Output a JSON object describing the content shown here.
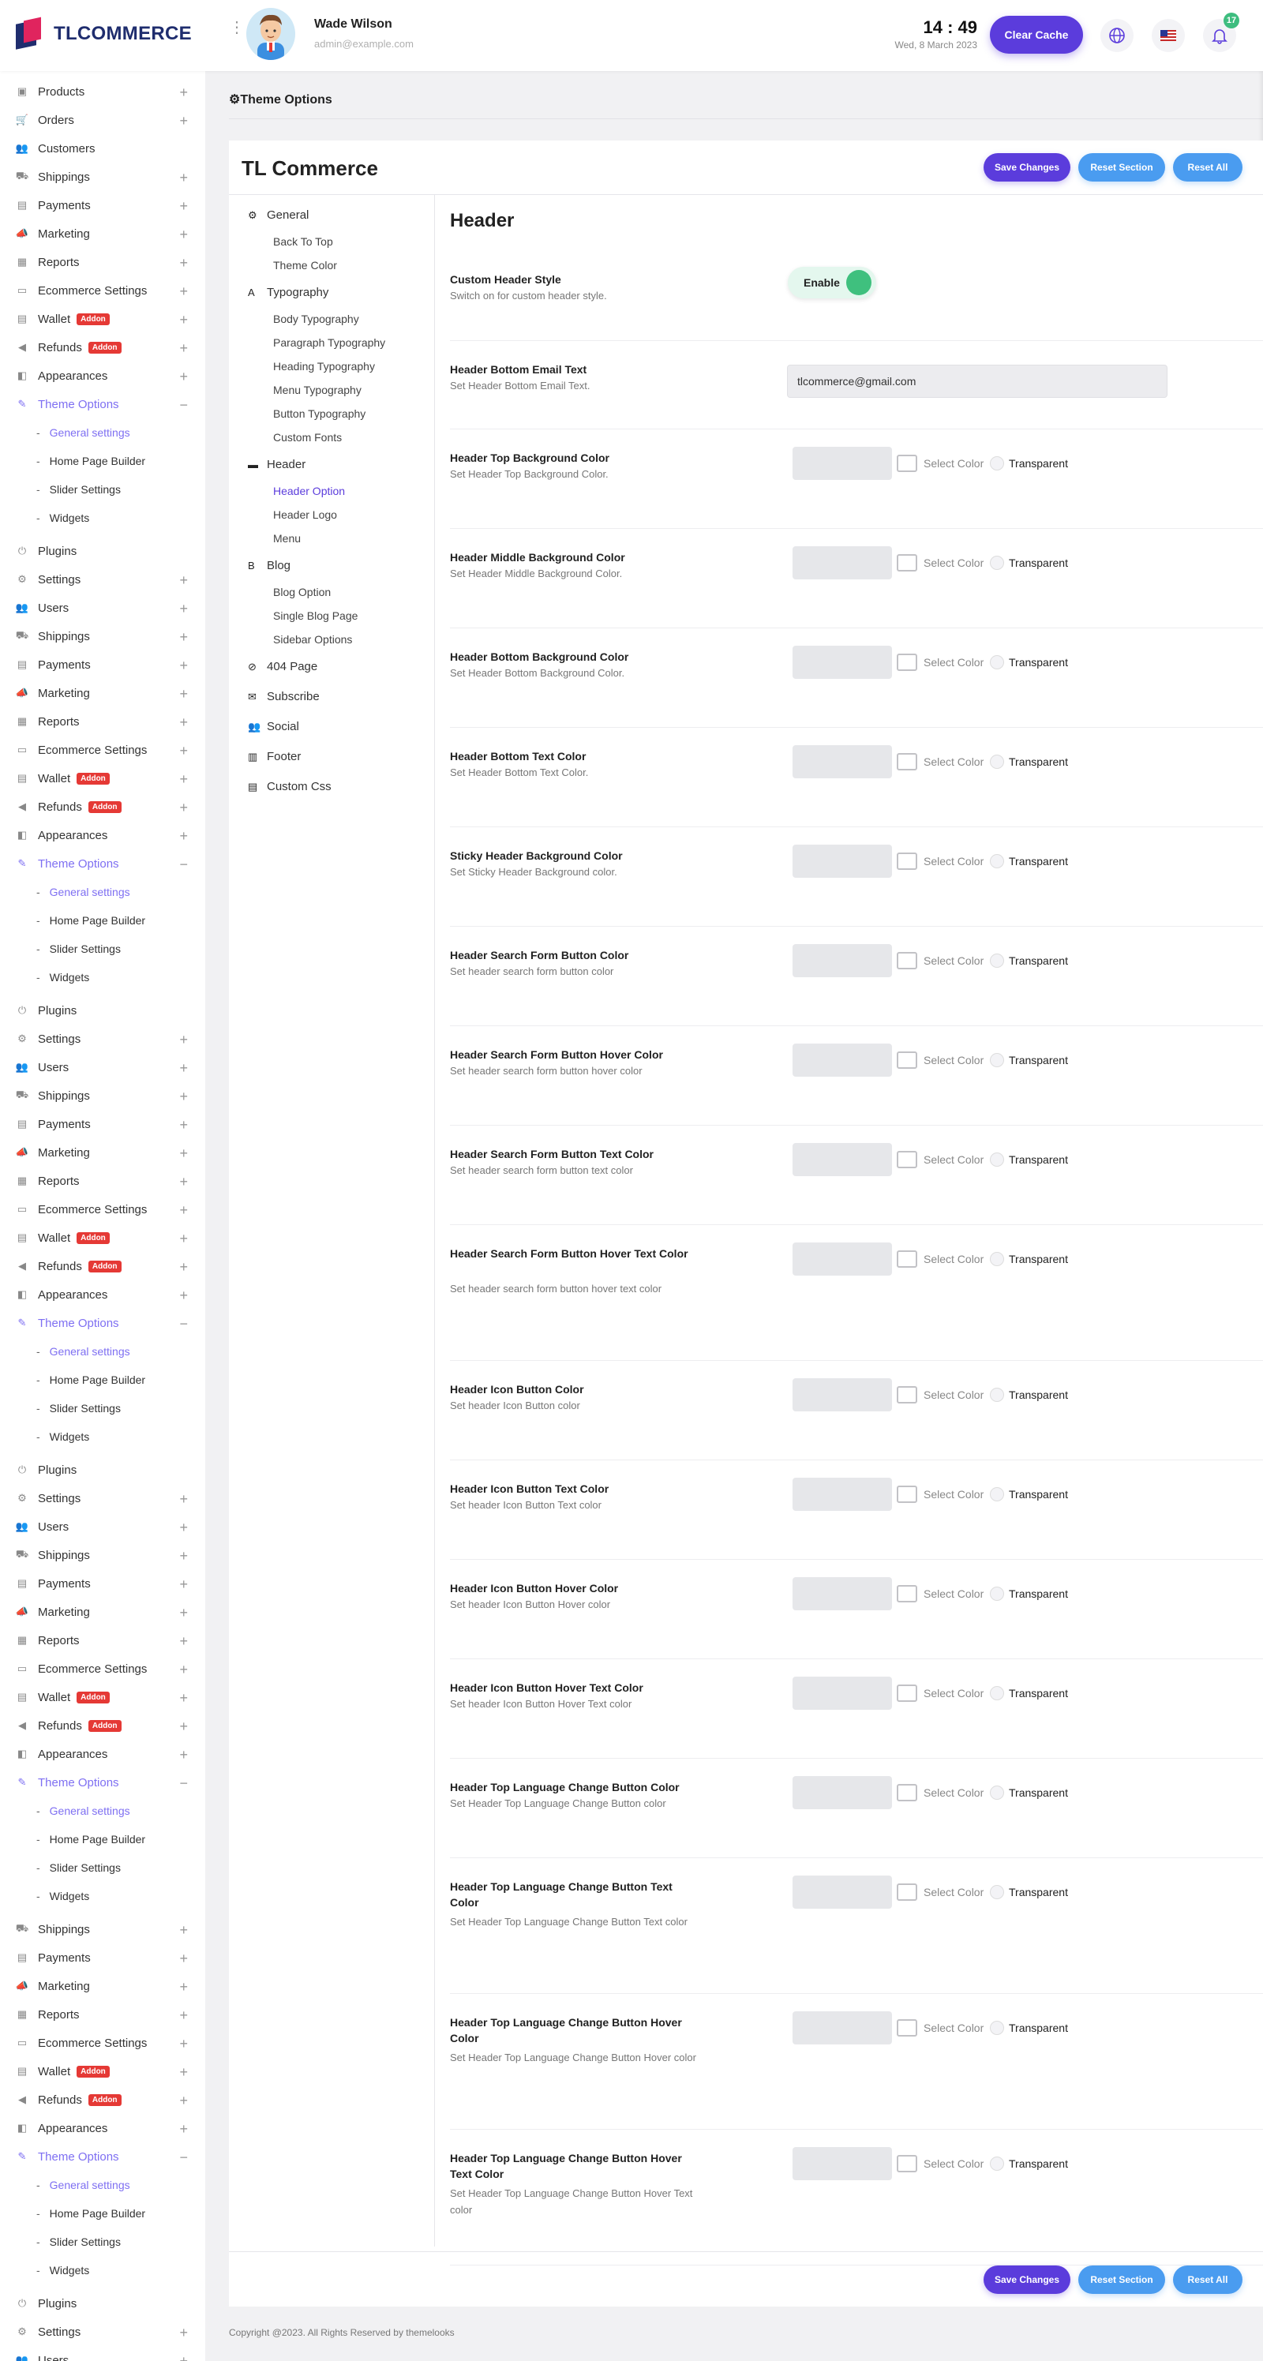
{
  "header": {
    "logo_text": "TLCOMMERCE",
    "user_name": "Wade Wilson",
    "user_email": "admin@example.com",
    "time": "14 : 49",
    "date": "Wed, 8 March 2023",
    "clear_cache_label": "Clear Cache",
    "notification_count": "17",
    "icons": [
      "globe-icon",
      "us-flag-icon",
      "bell-icon"
    ],
    "accent_color": "#5b3cdc"
  },
  "sidebar": {
    "groups": [
      {
        "type": "item",
        "label": "Products",
        "icon": "box-icon",
        "expandable": true
      },
      {
        "type": "item",
        "label": "Orders",
        "icon": "cart-icon",
        "expandable": true
      },
      {
        "type": "item",
        "label": "Customers",
        "icon": "users-icon",
        "expandable": false
      },
      {
        "type": "item",
        "label": "Shippings",
        "icon": "truck-icon",
        "expandable": true
      },
      {
        "type": "item",
        "label": "Payments",
        "icon": "wallet-icon",
        "expandable": true
      },
      {
        "type": "item",
        "label": "Marketing",
        "icon": "megaphone-icon",
        "expandable": true
      },
      {
        "type": "item",
        "label": "Reports",
        "icon": "report-icon",
        "expandable": true
      },
      {
        "type": "item",
        "label": "Ecommerce Settings",
        "icon": "card-icon",
        "expandable": true
      },
      {
        "type": "item",
        "label": "Wallet",
        "icon": "wallet-icon",
        "expandable": true,
        "addon": "Addon"
      },
      {
        "type": "item",
        "label": "Refunds",
        "icon": "refund-icon",
        "expandable": true,
        "addon": "Addon"
      },
      {
        "type": "item",
        "label": "Appearances",
        "icon": "palette-icon",
        "expandable": true
      },
      {
        "type": "item",
        "label": "Theme Options",
        "icon": "brush-icon",
        "expandable": true,
        "active": true,
        "open": true
      },
      {
        "type": "sub",
        "label": "General settings",
        "active": true
      },
      {
        "type": "sub",
        "label": "Home Page Builder"
      },
      {
        "type": "sub",
        "label": "Slider Settings"
      },
      {
        "type": "sub",
        "label": "Widgets"
      },
      {
        "type": "gap"
      },
      {
        "type": "item",
        "label": "Plugins",
        "icon": "plug-icon",
        "expandable": false
      },
      {
        "type": "item",
        "label": "Settings",
        "icon": "gear-icon",
        "expandable": true
      },
      {
        "type": "item",
        "label": "Users",
        "icon": "users-icon",
        "expandable": true
      },
      {
        "type": "item",
        "label": "Shippings",
        "icon": "truck-icon",
        "expandable": true
      },
      {
        "type": "item",
        "label": "Payments",
        "icon": "wallet-icon",
        "expandable": true
      },
      {
        "type": "item",
        "label": "Marketing",
        "icon": "megaphone-icon",
        "expandable": true
      },
      {
        "type": "item",
        "label": "Reports",
        "icon": "report-icon",
        "expandable": true
      },
      {
        "type": "item",
        "label": "Ecommerce Settings",
        "icon": "card-icon",
        "expandable": true
      },
      {
        "type": "item",
        "label": "Wallet",
        "icon": "wallet-icon",
        "expandable": true,
        "addon": "Addon"
      },
      {
        "type": "item",
        "label": "Refunds",
        "icon": "refund-icon",
        "expandable": true,
        "addon": "Addon"
      },
      {
        "type": "item",
        "label": "Appearances",
        "icon": "palette-icon",
        "expandable": true
      },
      {
        "type": "item",
        "label": "Theme Options",
        "icon": "brush-icon",
        "expandable": true,
        "active": true,
        "open": true
      },
      {
        "type": "sub",
        "label": "General settings",
        "active": true
      },
      {
        "type": "sub",
        "label": "Home Page Builder"
      },
      {
        "type": "sub",
        "label": "Slider Settings"
      },
      {
        "type": "sub",
        "label": "Widgets"
      },
      {
        "type": "gap"
      },
      {
        "type": "item",
        "label": "Plugins",
        "icon": "plug-icon",
        "expandable": false
      },
      {
        "type": "item",
        "label": "Settings",
        "icon": "gear-icon",
        "expandable": true
      },
      {
        "type": "item",
        "label": "Users",
        "icon": "users-icon",
        "expandable": true
      },
      {
        "type": "item",
        "label": "Shippings",
        "icon": "truck-icon",
        "expandable": true
      },
      {
        "type": "item",
        "label": "Payments",
        "icon": "wallet-icon",
        "expandable": true
      },
      {
        "type": "item",
        "label": "Marketing",
        "icon": "megaphone-icon",
        "expandable": true
      },
      {
        "type": "item",
        "label": "Reports",
        "icon": "report-icon",
        "expandable": true
      },
      {
        "type": "item",
        "label": "Ecommerce Settings",
        "icon": "card-icon",
        "expandable": true
      },
      {
        "type": "item",
        "label": "Wallet",
        "icon": "wallet-icon",
        "expandable": true,
        "addon": "Addon"
      },
      {
        "type": "item",
        "label": "Refunds",
        "icon": "refund-icon",
        "expandable": true,
        "addon": "Addon"
      },
      {
        "type": "item",
        "label": "Appearances",
        "icon": "palette-icon",
        "expandable": true
      },
      {
        "type": "item",
        "label": "Theme Options",
        "icon": "brush-icon",
        "expandable": true,
        "active": true,
        "open": true
      },
      {
        "type": "sub",
        "label": "General settings",
        "active": true
      },
      {
        "type": "sub",
        "label": "Home Page Builder"
      },
      {
        "type": "sub",
        "label": "Slider Settings"
      },
      {
        "type": "sub",
        "label": "Widgets"
      },
      {
        "type": "gap"
      },
      {
        "type": "item",
        "label": "Plugins",
        "icon": "plug-icon",
        "expandable": false
      },
      {
        "type": "item",
        "label": "Settings",
        "icon": "gear-icon",
        "expandable": true
      },
      {
        "type": "item",
        "label": "Users",
        "icon": "users-icon",
        "expandable": true
      },
      {
        "type": "item",
        "label": "Shippings",
        "icon": "truck-icon",
        "expandable": true
      },
      {
        "type": "item",
        "label": "Payments",
        "icon": "wallet-icon",
        "expandable": true
      },
      {
        "type": "item",
        "label": "Marketing",
        "icon": "megaphone-icon",
        "expandable": true
      },
      {
        "type": "item",
        "label": "Reports",
        "icon": "report-icon",
        "expandable": true
      },
      {
        "type": "item",
        "label": "Ecommerce Settings",
        "icon": "card-icon",
        "expandable": true
      },
      {
        "type": "item",
        "label": "Wallet",
        "icon": "wallet-icon",
        "expandable": true,
        "addon": "Addon"
      },
      {
        "type": "item",
        "label": "Refunds",
        "icon": "refund-icon",
        "expandable": true,
        "addon": "Addon"
      },
      {
        "type": "item",
        "label": "Appearances",
        "icon": "palette-icon",
        "expandable": true
      },
      {
        "type": "item",
        "label": "Theme Options",
        "icon": "brush-icon",
        "expandable": true,
        "active": true,
        "open": true
      },
      {
        "type": "sub",
        "label": "General settings",
        "active": true
      },
      {
        "type": "sub",
        "label": "Home Page Builder"
      },
      {
        "type": "sub",
        "label": "Slider Settings"
      },
      {
        "type": "sub",
        "label": "Widgets"
      },
      {
        "type": "gap"
      },
      {
        "type": "item",
        "label": "Shippings",
        "icon": "truck-icon",
        "expandable": true
      },
      {
        "type": "item",
        "label": "Payments",
        "icon": "wallet-icon",
        "expandable": true
      },
      {
        "type": "item",
        "label": "Marketing",
        "icon": "megaphone-icon",
        "expandable": true
      },
      {
        "type": "item",
        "label": "Reports",
        "icon": "report-icon",
        "expandable": true
      },
      {
        "type": "item",
        "label": "Ecommerce Settings",
        "icon": "card-icon",
        "expandable": true
      },
      {
        "type": "item",
        "label": "Wallet",
        "icon": "wallet-icon",
        "expandable": true,
        "addon": "Addon"
      },
      {
        "type": "item",
        "label": "Refunds",
        "icon": "refund-icon",
        "expandable": true,
        "addon": "Addon"
      },
      {
        "type": "item",
        "label": "Appearances",
        "icon": "palette-icon",
        "expandable": true
      },
      {
        "type": "item",
        "label": "Theme Options",
        "icon": "brush-icon",
        "expandable": true,
        "active": true,
        "open": true
      },
      {
        "type": "sub",
        "label": "General settings",
        "active": true
      },
      {
        "type": "sub",
        "label": "Home Page Builder"
      },
      {
        "type": "sub",
        "label": "Slider Settings"
      },
      {
        "type": "sub",
        "label": "Widgets"
      },
      {
        "type": "gap"
      },
      {
        "type": "item",
        "label": "Plugins",
        "icon": "plug-icon",
        "expandable": false
      },
      {
        "type": "item",
        "label": "Settings",
        "icon": "gear-icon",
        "expandable": true
      },
      {
        "type": "item",
        "label": "Users",
        "icon": "users-icon",
        "expandable": true
      }
    ]
  },
  "page": {
    "title": "Theme Options",
    "card_title": "TL Commerce",
    "save_label": "Save Changes",
    "reset_section_label": "Reset Section",
    "reset_all_label": "Reset All",
    "copyright": "Copyright @2023. All Rights Reserved by themelooks"
  },
  "options_menu": [
    {
      "type": "section",
      "label": "General",
      "icon": "gears-icon"
    },
    {
      "type": "sub",
      "label": "Back To Top"
    },
    {
      "type": "sub",
      "label": "Theme Color"
    },
    {
      "type": "section",
      "label": "Typography",
      "icon": "font-icon"
    },
    {
      "type": "sub",
      "label": "Body Typography"
    },
    {
      "type": "sub",
      "label": "Paragraph Typography"
    },
    {
      "type": "sub",
      "label": "Heading Typography"
    },
    {
      "type": "sub",
      "label": "Menu Typography"
    },
    {
      "type": "sub",
      "label": "Button Typography"
    },
    {
      "type": "sub",
      "label": "Custom Fonts"
    },
    {
      "type": "section",
      "label": "Header",
      "icon": "header-icon"
    },
    {
      "type": "sub",
      "label": "Header Option",
      "active": true
    },
    {
      "type": "sub",
      "label": "Header Logo"
    },
    {
      "type": "sub",
      "label": "Menu"
    },
    {
      "type": "section",
      "label": "Blog",
      "icon": "blog-icon"
    },
    {
      "type": "sub",
      "label": "Blog Option"
    },
    {
      "type": "sub",
      "label": "Single Blog Page"
    },
    {
      "type": "sub",
      "label": "Sidebar Options"
    },
    {
      "type": "section",
      "label": "404 Page",
      "icon": "ban-icon"
    },
    {
      "type": "section",
      "label": "Subscribe",
      "icon": "envelope-icon"
    },
    {
      "type": "section",
      "label": "Social",
      "icon": "social-icon"
    },
    {
      "type": "section",
      "label": "Footer",
      "icon": "footer-icon"
    },
    {
      "type": "section",
      "label": "Custom Css",
      "icon": "css-icon"
    }
  ],
  "settings": {
    "section_title": "Header",
    "select_color_label": "Select Color",
    "transparent_label": "Transparent",
    "rows": [
      {
        "kind": "toggle",
        "label": "Custom Header Style",
        "desc": "Switch on for custom header style.",
        "value": "Enable"
      },
      {
        "kind": "text",
        "label": "Header Bottom Email Text",
        "desc": "Set Header Bottom Email Text.",
        "value": "tlcommerce@gmail.com"
      },
      {
        "kind": "color",
        "label": "Header Top Background Color",
        "desc": "Set Header Top Background Color."
      },
      {
        "kind": "color",
        "label": "Header Middle Background Color",
        "desc": "Set Header Middle Background Color."
      },
      {
        "kind": "color",
        "label": "Header Bottom Background Color",
        "desc": "Set Header Bottom Background Color."
      },
      {
        "kind": "color",
        "label": "Header Bottom Text Color",
        "desc": "Set Header Bottom Text Color."
      },
      {
        "kind": "color",
        "label": "Sticky Header Background Color",
        "desc": "Set Sticky Header Background color."
      },
      {
        "kind": "color",
        "label": "Header Search Form Button Color",
        "desc": "Set header search form button color"
      },
      {
        "kind": "color",
        "label": "Header Search Form Button Hover Color",
        "desc": "Set header search form button hover color"
      },
      {
        "kind": "color",
        "label": "Header Search Form Button Text Color",
        "desc": "Set header search form button text color"
      },
      {
        "kind": "color",
        "label": "Header Search Form Button Hover Text Color",
        "desc": "Set header search form button hover text color"
      },
      {
        "kind": "color",
        "label": "Header Icon Button Color",
        "desc": "Set header Icon Button color"
      },
      {
        "kind": "color",
        "label": "Header Icon Button Text Color",
        "desc": "Set header Icon Button Text color"
      },
      {
        "kind": "color",
        "label": "Header Icon Button Hover Color",
        "desc": "Set header Icon Button Hover color"
      },
      {
        "kind": "color",
        "label": "Header Icon Button Hover Text Color",
        "desc": "Set header Icon Button Hover Text color"
      },
      {
        "kind": "color",
        "label": "Header Top Language Change Button Color",
        "desc": "Set Header Top Language Change Button color"
      },
      {
        "kind": "color",
        "label": "Header Top Language Change Button Text Color",
        "desc": "Set Header Top Language Change Button Text color"
      },
      {
        "kind": "color",
        "label": "Header Top Language Change Button Hover Color",
        "desc": "Set Header Top Language Change Button Hover color"
      },
      {
        "kind": "color",
        "label": "Header Top Language Change Button Hover Text Color",
        "desc": "Set Header Top Language Change Button Hover Text color"
      }
    ]
  }
}
